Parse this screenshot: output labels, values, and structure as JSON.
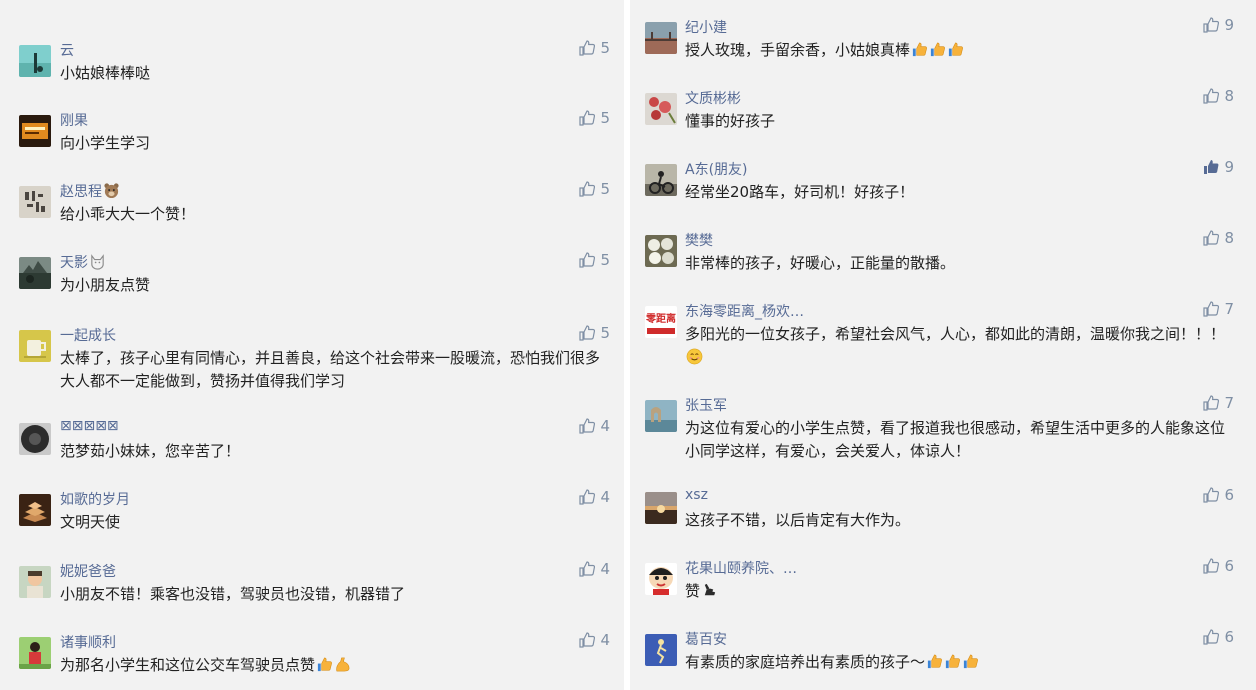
{
  "left_column": [
    {
      "name": "云",
      "text": "小姑娘棒棒哒",
      "likes": "5",
      "liked": false,
      "avatar": "teal-scene",
      "emojis": []
    },
    {
      "name": "刚果",
      "text": "向小学生学习",
      "likes": "5",
      "liked": false,
      "avatar": "orange-book",
      "emojis": []
    },
    {
      "name": "赵思程",
      "name_emoji": "bear-face",
      "text": "给小乖大大一个赞！",
      "likes": "5",
      "liked": false,
      "avatar": "calligraphy",
      "emojis": []
    },
    {
      "name": "天影",
      "name_emoji": "cat-face",
      "text": "为小朋友点赞",
      "likes": "5",
      "liked": false,
      "avatar": "dark-landscape",
      "emojis": []
    },
    {
      "name": "一起成长",
      "text": "太棒了，孩子心里有同情心，并且善良，给这个社会带来一股暖流，恐怕我们很多大人都不一定能做到，赞扬并值得我们学习",
      "likes": "5",
      "liked": false,
      "avatar": "yellow-cup",
      "emojis": []
    },
    {
      "name": "⊠⊠⊠⊠⊠",
      "text": "范梦茹小妹妹，您辛苦了！",
      "likes": "4",
      "liked": false,
      "avatar": "dark-circle",
      "emojis": []
    },
    {
      "name": "如歌的岁月",
      "text": "文明天使",
      "likes": "4",
      "liked": false,
      "avatar": "brown-stack",
      "emojis": []
    },
    {
      "name": "妮妮爸爸",
      "text": "小朋友不错！乘客也没错，驾驶员也没错，机器错了",
      "likes": "4",
      "liked": false,
      "avatar": "child-photo",
      "emojis": []
    },
    {
      "name": "诸事顺利",
      "text": "为那名小学生和这位公交车驾驶员点赞",
      "likes": "4",
      "liked": false,
      "avatar": "red-figure",
      "emojis": [
        "thumbs-up",
        "flexed-biceps"
      ]
    }
  ],
  "right_column": [
    {
      "name": "纪小建",
      "text": "授人玫瑰，手留余香，小姑娘真棒",
      "likes": "9",
      "liked": false,
      "avatar": "bridge-scene",
      "emojis": [
        "thumbs-up",
        "thumbs-up",
        "thumbs-up"
      ]
    },
    {
      "name": "文质彬彬",
      "text": "懂事的好孩子",
      "likes": "8",
      "liked": false,
      "avatar": "red-flowers",
      "emojis": []
    },
    {
      "name": "A东(朋友)",
      "text": "经常坐20路车，好司机！好孩子！",
      "likes": "9",
      "liked": true,
      "avatar": "cyclist",
      "emojis": []
    },
    {
      "name": "樊樊",
      "text": "非常棒的孩子，好暖心，正能量的散播。",
      "likes": "8",
      "liked": false,
      "avatar": "white-balls",
      "emojis": []
    },
    {
      "name": "东海零距离_杨欢…",
      "text": "多阳光的一位女孩子，希望社会风气，人心，都如此的清朗，温暖你我之间！！！",
      "likes": "7",
      "liked": false,
      "avatar": "news-logo",
      "avatar_text": "零距离",
      "emojis": [
        "smiling-face"
      ]
    },
    {
      "name": "张玉军",
      "text": "为这位有爱心的小学生点赞，看了报道我也很感动，希望生活中更多的人能象这位小同学这样，有爱心，会关爱人，体谅人！",
      "likes": "7",
      "liked": false,
      "avatar": "rock-arch",
      "emojis": []
    },
    {
      "name": "xsz",
      "text": "这孩子不错，以后肯定有大作为。",
      "likes": "6",
      "liked": false,
      "avatar": "sunset",
      "emojis": []
    },
    {
      "name": "花果山颐养院、…",
      "text": "赞",
      "likes": "6",
      "liked": false,
      "avatar": "cartoon-boy",
      "emojis": [
        "pointing-hand"
      ]
    },
    {
      "name": "葛百安",
      "text": "有素质的家庭培养出有素质的孩子～",
      "likes": "6",
      "liked": false,
      "avatar": "blue-runner",
      "emojis": [
        "thumbs-up",
        "thumbs-up",
        "thumbs-up"
      ]
    }
  ],
  "colors": {
    "name": "#576b95",
    "text": "#222222",
    "like": "#7f8fa4",
    "liked": "#576b95",
    "background": "#f2f2f2"
  }
}
